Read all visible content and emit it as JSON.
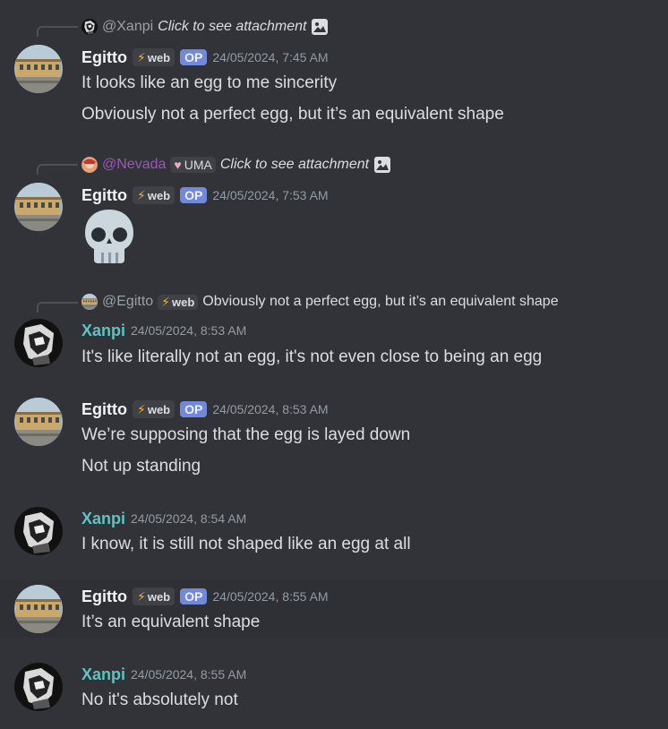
{
  "messages": [
    {
      "reply": {
        "name": "@Xanpi",
        "text": "Click to see attachment"
      },
      "author": "Egitto",
      "tag": "web",
      "op": "OP",
      "time": "24/05/2024, 7:45 AM",
      "lines": [
        "It looks like an egg to me sincerity",
        "Obviously not a perfect egg, but it’s an equivalent shape"
      ]
    },
    {
      "reply": {
        "name": "@Nevada",
        "badge": "UMA",
        "text": "Click to see attachment"
      },
      "author": "Egitto",
      "tag": "web",
      "op": "OP",
      "time": "24/05/2024, 7:53 AM",
      "emoji": "skull-emoji"
    },
    {
      "reply": {
        "name": "@Egitto",
        "tag": "web",
        "text": "Obviously not a perfect egg, but it’s an equivalent shape"
      },
      "author": "Xanpi",
      "time": "24/05/2024, 8:53 AM",
      "lines": [
        "It's like literally not an egg, it's not even close to being an egg"
      ]
    },
    {
      "author": "Egitto",
      "tag": "web",
      "op": "OP",
      "time": "24/05/2024, 8:53 AM",
      "lines": [
        "We’re supposing that the egg is layed down",
        "Not up standing"
      ]
    },
    {
      "author": "Xanpi",
      "time": "24/05/2024, 8:54 AM",
      "lines": [
        "I know, it is still not shaped like an egg at all"
      ]
    },
    {
      "author": "Egitto",
      "tag": "web",
      "op": "OP",
      "time": "24/05/2024, 8:55 AM",
      "lines": [
        "It’s an equivalent shape"
      ]
    },
    {
      "author": "Xanpi",
      "time": "24/05/2024, 8:55 AM",
      "lines": [
        "No it's absolutely not"
      ]
    }
  ],
  "icons": {
    "attachment": "image-icon",
    "tag_bolt": "lightning-icon",
    "uma_badge": "heart-icon"
  },
  "colors": {
    "background": "#313338",
    "xanpi": "#5fc4c1",
    "nevada": "#9b59b6",
    "op_badge": "#7289da"
  }
}
